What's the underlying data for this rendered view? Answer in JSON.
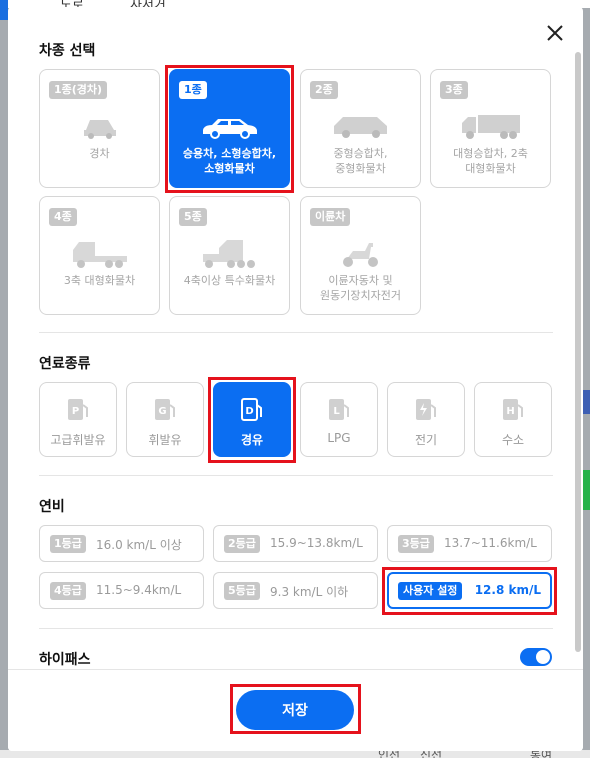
{
  "map": {
    "top_texts": [
      "노로",
      "사서거"
    ],
    "bottom_texts": [
      "인선",
      "신선",
      "통여"
    ]
  },
  "dialog": {
    "close_icon": "close-icon",
    "sections": {
      "vehicle_title": "차종 선택",
      "fuel_title": "연료종류",
      "efficiency_title": "연비",
      "hipass_title": "하이패스"
    },
    "vehicles": [
      {
        "badge": "1종(경차)",
        "label": "경차",
        "icon": "compact-car-icon",
        "selected": false
      },
      {
        "badge": "1종",
        "label": "승용차, 소형승합차,\n소형화물차",
        "icon": "sedan-car-icon",
        "selected": true
      },
      {
        "badge": "2종",
        "label": "중형승합차,\n중형화물차",
        "icon": "van-icon",
        "selected": false
      },
      {
        "badge": "3종",
        "label": "대형승합차, 2축\n대형화물차",
        "icon": "truck-icon",
        "selected": false
      },
      {
        "badge": "4종",
        "label": "3축 대형화물차",
        "icon": "big-truck-icon",
        "selected": false
      },
      {
        "badge": "5종",
        "label": "4축이상 특수화물차",
        "icon": "special-truck-icon",
        "selected": false
      },
      {
        "badge": "이륜차",
        "label": "이륜자동차 및\n원동기장치자전거",
        "icon": "scooter-icon",
        "selected": false
      }
    ],
    "fuels": [
      {
        "label": "고급휘발유",
        "icon": "premium-gasoline-icon",
        "letter": "P",
        "selected": false
      },
      {
        "label": "휘발유",
        "icon": "gasoline-icon",
        "letter": "G",
        "selected": false
      },
      {
        "label": "경유",
        "icon": "diesel-icon",
        "letter": "D",
        "selected": true
      },
      {
        "label": "LPG",
        "icon": "lpg-icon",
        "letter": "L",
        "selected": false
      },
      {
        "label": "전기",
        "icon": "electric-icon",
        "letter": "",
        "selected": false
      },
      {
        "label": "수소",
        "icon": "hydrogen-icon",
        "letter": "H",
        "selected": false
      }
    ],
    "efficiency": [
      {
        "badge": "1등급",
        "value": "16.0 km/L 이상",
        "selected": false
      },
      {
        "badge": "2등급",
        "value": "15.9~13.8km/L",
        "selected": false
      },
      {
        "badge": "3등급",
        "value": "13.7~11.6km/L",
        "selected": false
      },
      {
        "badge": "4등급",
        "value": "11.5~9.4km/L",
        "selected": false
      },
      {
        "badge": "5등급",
        "value": "9.3 km/L 이하",
        "selected": false
      },
      {
        "badge": "사용자 설정",
        "value": "12.8 km/L",
        "selected": true
      }
    ],
    "hipass_enabled": true,
    "save_label": "저장",
    "colors": {
      "accent": "#0b6ef2",
      "highlight": "#e5121c",
      "disabled": "#c7c7c7"
    }
  }
}
